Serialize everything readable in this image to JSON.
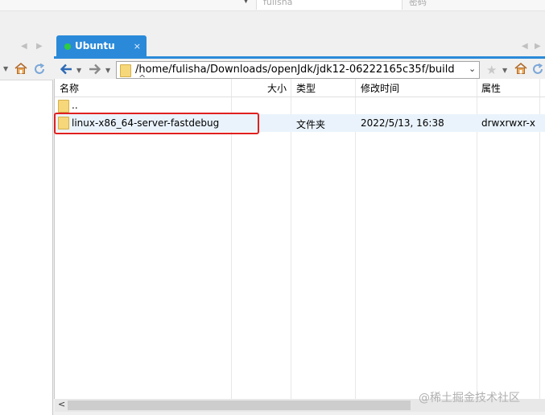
{
  "login": {
    "username": "fulisha",
    "password_label": "密码"
  },
  "tab": {
    "title": "Ubuntu",
    "close": "×"
  },
  "toolbar": {
    "path": "/home/fulisha/Downloads/openJdk/jdk12-06222165c35f/build"
  },
  "columns": {
    "name": "名称",
    "size": "大小",
    "type": "类型",
    "modified": "修改时间",
    "attributes": "属性"
  },
  "rows": [
    {
      "name": "..",
      "size": "",
      "type": "",
      "modified": "",
      "attributes": ""
    },
    {
      "name": "linux-x86_64-server-fastdebug",
      "size": "",
      "type": "文件夹",
      "modified": "2022/5/13, 16:38",
      "attributes": "drwxrwxr-x"
    }
  ],
  "watermark": "@稀土掘金技术社区",
  "colors": {
    "tab": "#2a8ad9",
    "highlight": "#e02020",
    "folder": "#f6d77a",
    "selected_row": "#eaf3fc"
  },
  "icons": [
    "back-arrow-icon",
    "forward-arrow-icon",
    "home-icon",
    "refresh-icon",
    "bookmark-star-icon",
    "folder-icon"
  ]
}
